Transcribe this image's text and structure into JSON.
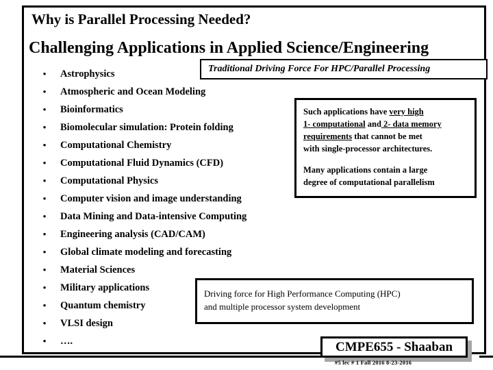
{
  "slide": {
    "title": "Why is Parallel Processing Needed?",
    "subtitle": "Challenging Applications in Applied Science/Engineering",
    "bullet_marker": "•",
    "bullets": [
      "Astrophysics",
      "Atmospheric and Ocean Modeling",
      "Bioinformatics",
      "Biomolecular simulation: Protein folding",
      "Computational Chemistry",
      "Computational Fluid Dynamics (CFD)",
      "Computational Physics",
      "Computer vision and image understanding",
      "Data Mining and Data-intensive Computing",
      "Engineering analysis (CAD/CAM)",
      "Global climate modeling and forecasting",
      "Material Sciences",
      "Military applications",
      "Quantum chemistry",
      "VLSI design",
      "…."
    ]
  },
  "callouts": {
    "traditional": {
      "text": "Traditional Driving Force For HPC/Parallel Processing"
    },
    "requirements": {
      "line1_pre": "Such applications have ",
      "line1_underline": "very high",
      "line2_underline_a": "1- computational",
      "line2_mid": " and",
      "line2_underline_b": " 2- data memory",
      "line3_underline": "requirements",
      "line3_post": " that cannot be met",
      "line4": "with single-processor architectures.",
      "para2_line1": "Many applications contain a large",
      "para2_line2": "degree of computational parallelism"
    },
    "driving_force": {
      "line1": "Driving force for High Performance Computing (HPC)",
      "line2": "and multiple processor system development"
    }
  },
  "footer": {
    "banner": "CMPE655 - Shaaban",
    "meta": "#5  lec # 1   Fall 2016   8-23-2016"
  },
  "colors": {
    "background": "#ffffff",
    "foreground": "#000000",
    "shadow": "#a6a6a6"
  }
}
